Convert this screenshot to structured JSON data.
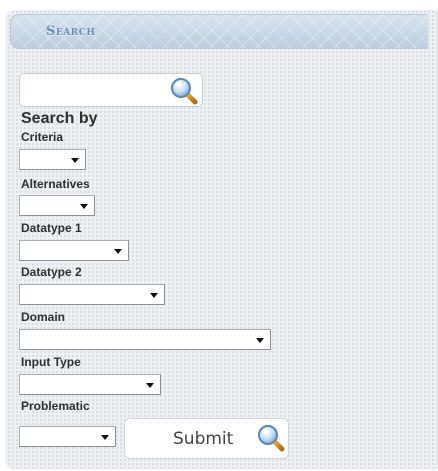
{
  "header": {
    "title": "Search"
  },
  "search": {
    "value": ""
  },
  "form": {
    "heading": "Search by",
    "fields": [
      {
        "label": "Criteria",
        "value": ""
      },
      {
        "label": "Alternatives",
        "value": ""
      },
      {
        "label": "Datatype 1",
        "value": ""
      },
      {
        "label": "Datatype 2",
        "value": ""
      },
      {
        "label": "Domain",
        "value": ""
      },
      {
        "label": "Input Type",
        "value": ""
      },
      {
        "label": "Problematic",
        "value": ""
      }
    ]
  },
  "submit": {
    "label": "Submit"
  },
  "icons": {
    "search": "magnifier-icon",
    "dropdown": "caret-down-icon"
  },
  "colors": {
    "header_text": "#6d8fb3",
    "header_bg": "#c6d6e6",
    "label_text": "#2f2f2f"
  }
}
